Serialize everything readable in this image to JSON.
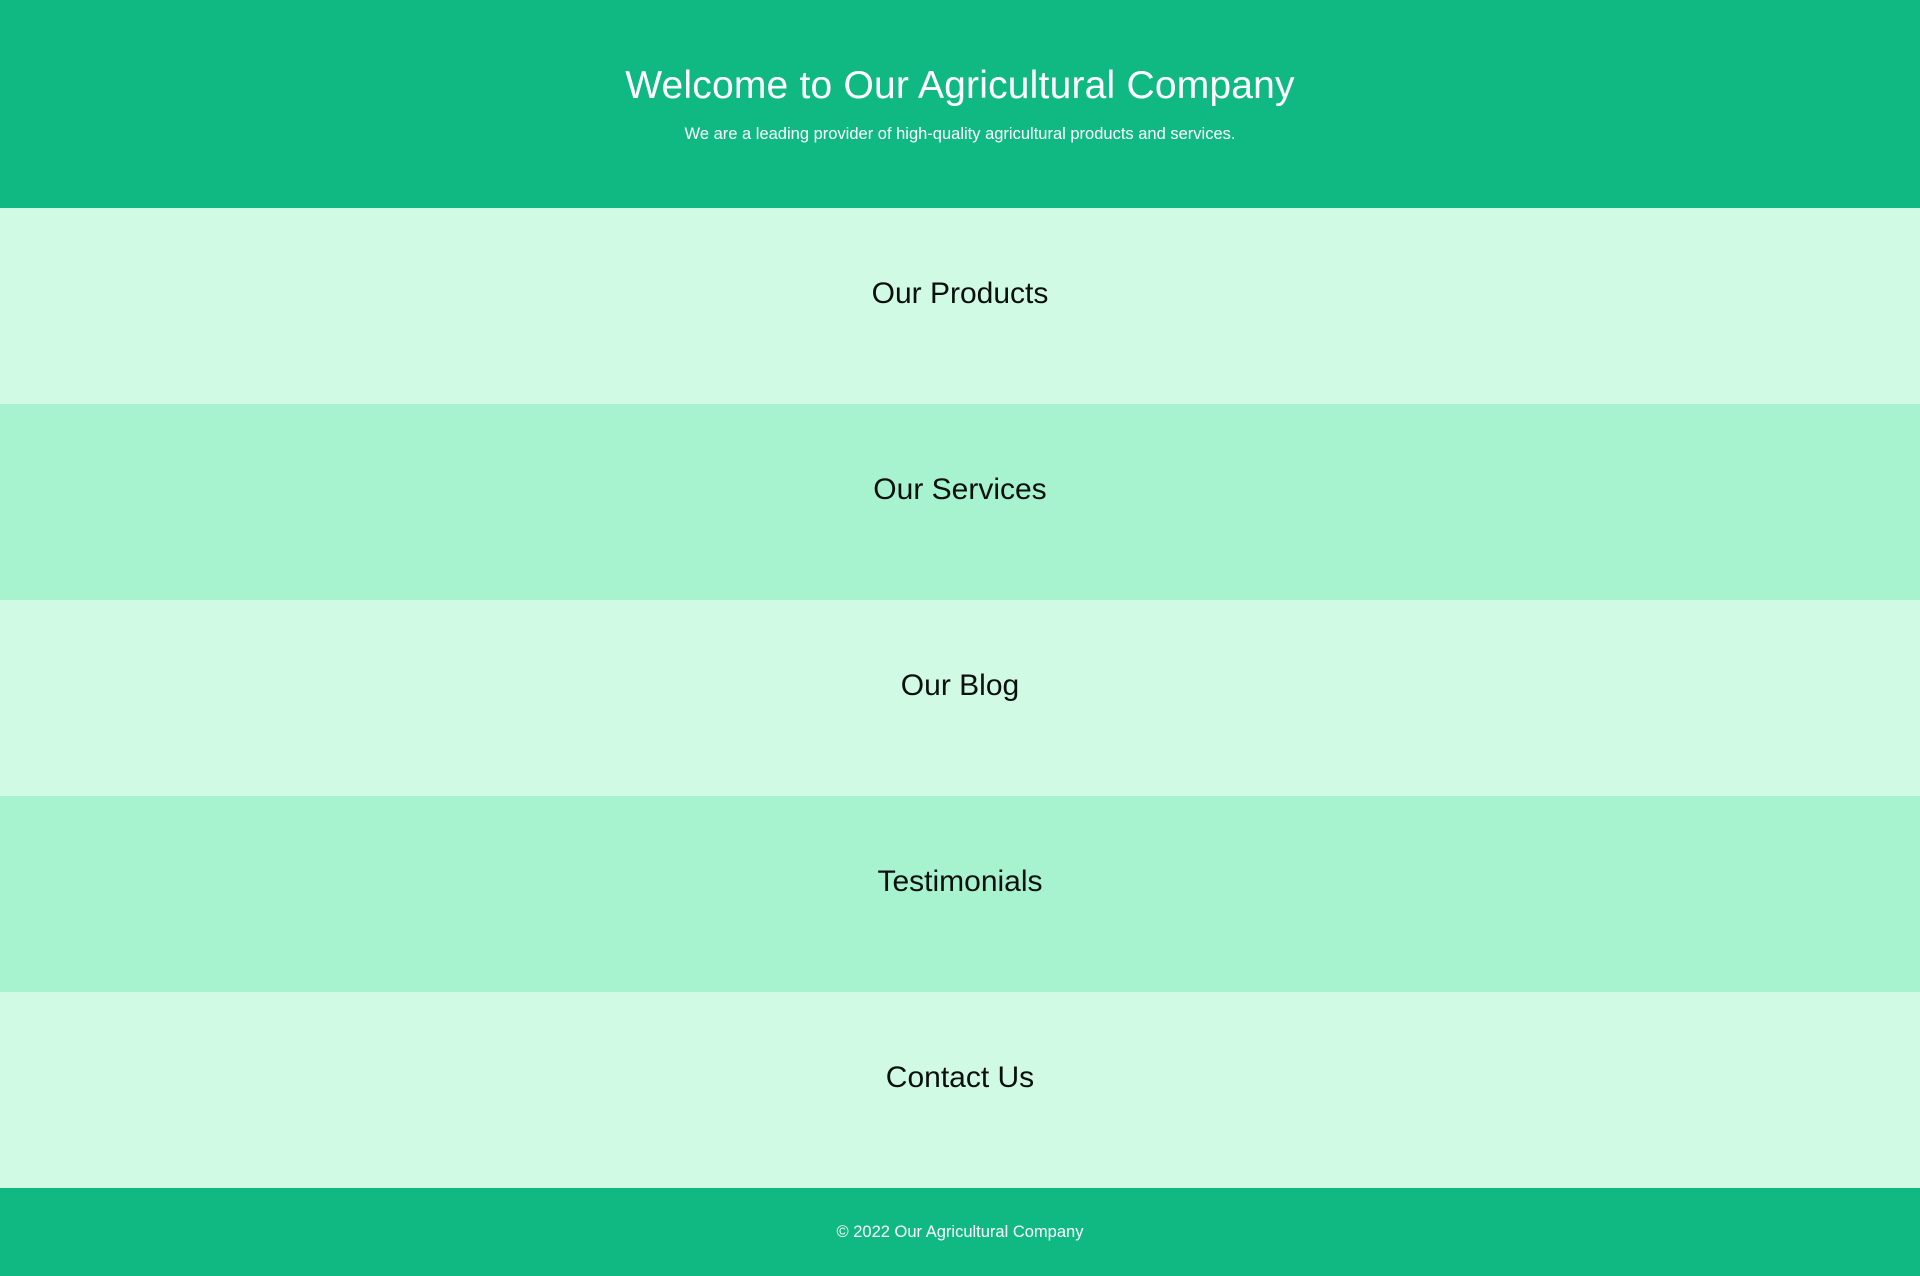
{
  "header": {
    "title": "Welcome to Our Agricultural Company",
    "subtitle": "We are a leading provider of high-quality agricultural products and services."
  },
  "sections": [
    {
      "title": "Our Products"
    },
    {
      "title": "Our Services"
    },
    {
      "title": "Our Blog"
    },
    {
      "title": "Testimonials"
    },
    {
      "title": "Contact Us"
    }
  ],
  "footer": {
    "text": "© 2022 Our Agricultural Company"
  },
  "colors": {
    "brand_green": "#10b981",
    "section_light": "#d1fae5",
    "section_mid": "#a7f3d0",
    "header_text": "#ffffff",
    "section_text": "#0b0f0d"
  }
}
